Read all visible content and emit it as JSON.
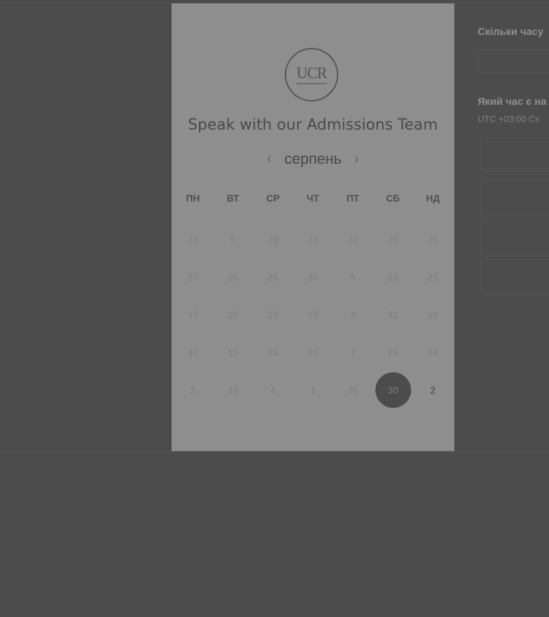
{
  "card": {
    "logo_text": "UCR",
    "title": "Speak with our Admissions Team",
    "month": "серпень",
    "prev_icon": "‹",
    "next_icon": "›",
    "weekdays": [
      "ПН",
      "ВТ",
      "СР",
      "ЧТ",
      "ПТ",
      "СБ",
      "НД"
    ],
    "weeks": [
      [
        "23",
        "5",
        "29",
        "23",
        "27",
        "25",
        "25"
      ],
      [
        "20",
        "25",
        "26",
        "20",
        "5",
        "23",
        "25"
      ],
      [
        "17",
        "25",
        "20",
        "18",
        "4",
        "31",
        "16"
      ],
      [
        "31",
        "15",
        "29",
        "25",
        "7",
        "29",
        "24"
      ],
      [
        "2",
        "16",
        "4",
        "1",
        "26",
        "30",
        "2"
      ]
    ],
    "selected_day": "30",
    "available_day": "2"
  },
  "right_panel": {
    "question_duration": "Скільки часу",
    "question_time": "Який час є на",
    "timezone": "UTC +03:00 Сх"
  },
  "colors": {
    "overlay": "#4c4c4c",
    "card": "#8e8e8e",
    "selected_day_bg": "#4c4c4c"
  },
  "icons": {
    "prev": "chevron-left-icon",
    "next": "chevron-right-icon"
  }
}
